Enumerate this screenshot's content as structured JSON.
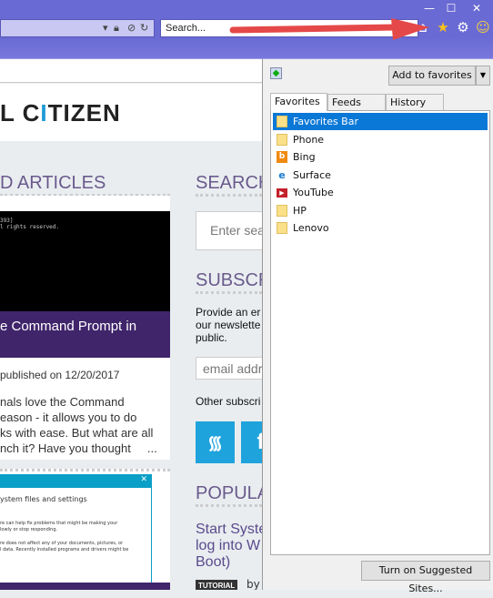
{
  "browser": {
    "search_placeholder": "Search...",
    "window_controls": {
      "minimize": "—",
      "maximize": "☐",
      "close": "✕"
    },
    "accent": "#6a6ad4"
  },
  "page": {
    "logo": {
      "prefix": "L C",
      "t": "I",
      "suffix": "TIZEN"
    },
    "articles_heading": "D ARTICLES",
    "article1": {
      "console": [
        "393]",
        "l rights reserved."
      ],
      "title": "e Command Prompt in",
      "published": "published on 12/20/2017",
      "excerpt": "nals love the Command\neason - it allows you to do\nks with ease. But what are all\nnch it? Have you thought     ..."
    },
    "article2": {
      "dialog_close": "✕",
      "dialog_title": "ystem files and settings",
      "lines": [
        "re can help fix problems that might be making your",
        "lowly or stop responding.",
        "re does not affect any of your documents, pictures, or",
        "l data. Recently installed programs and drivers might be"
      ]
    },
    "search_heading": "SEARCH",
    "search_placeholder": "Enter sea",
    "subscribe_heading": "SUBSCR",
    "subscribe_text": "Provide an er\nour newslette\npublic.",
    "email_placeholder": "email addr",
    "other_subscriptions": "Other subscri",
    "social": [
      "rss",
      "f"
    ],
    "popular_heading": "POPULA",
    "popular_title": "Start Syste\nlog into W\nBoot)",
    "popular_badge": "TUTORIAL",
    "popular_by": "by"
  },
  "favorites_center": {
    "add_button": "Add to favorites",
    "dropdown": "▼",
    "tabs": [
      "Favorites",
      "Feeds",
      "History"
    ],
    "active_tab": "Favorites",
    "items": [
      {
        "label": "Favorites Bar",
        "icon": "folder",
        "selected": true
      },
      {
        "label": "Phone",
        "icon": "folder"
      },
      {
        "label": "Bing",
        "icon": "bing"
      },
      {
        "label": "Surface",
        "icon": "ie"
      },
      {
        "label": "YouTube",
        "icon": "youtube"
      },
      {
        "label": "HP",
        "icon": "folder"
      },
      {
        "label": "Lenovo",
        "icon": "folder"
      }
    ],
    "suggested_button": "Turn on Suggested Sites...",
    "selection_color": "#0a78d7"
  }
}
